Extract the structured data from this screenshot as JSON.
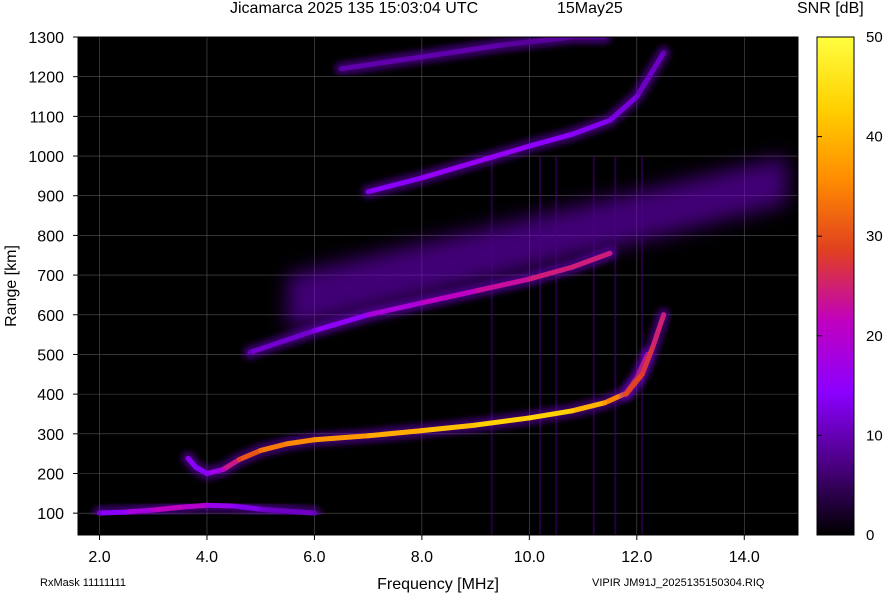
{
  "chart_data": {
    "type": "heatmap",
    "title": "Jicamarca 2025 135 15:03:04 UTC",
    "date_label": "15May25",
    "xlabel": "Frequency [MHz]",
    "ylabel": "Range [km]",
    "colorbar_label": "SNR [dB]",
    "xlim": [
      1.6,
      15.0
    ],
    "ylim": [
      45,
      1300
    ],
    "x_ticks": [
      2.0,
      4.0,
      6.0,
      8.0,
      10.0,
      12.0,
      14.0
    ],
    "x_tick_labels": [
      "2.0",
      "4.0",
      "6.0",
      "8.0",
      "10.0",
      "12.0",
      "14.0"
    ],
    "y_ticks": [
      100,
      200,
      300,
      400,
      500,
      600,
      700,
      800,
      900,
      1000,
      1100,
      1200,
      1300
    ],
    "y_tick_labels": [
      "100",
      "200",
      "300",
      "400",
      "500",
      "600",
      "700",
      "800",
      "900",
      "1000",
      "1100",
      "1200",
      "1300"
    ],
    "colorbar_ticks": [
      0,
      10,
      20,
      30,
      40,
      50
    ],
    "colorbar_tick_labels": [
      "0",
      "10",
      "20",
      "30",
      "40",
      "50"
    ],
    "colorbar_range": [
      0,
      50
    ],
    "grid": true,
    "background_color": "#000000",
    "colormap": [
      "#000000",
      "#4b0082",
      "#8b00ff",
      "#c000c0",
      "#e04020",
      "#ff8c00",
      "#ffd000",
      "#ffff40"
    ],
    "traces": [
      {
        "frequency": [
          3.65,
          3.8,
          4.0,
          4.3,
          4.6,
          5.0,
          5.5,
          6.0,
          7.0,
          8.0,
          9.0,
          10.0,
          10.8,
          11.4,
          11.8,
          12.0,
          12.2
        ],
        "range": [
          238,
          215,
          200,
          210,
          235,
          258,
          275,
          285,
          295,
          308,
          322,
          340,
          358,
          378,
          402,
          440,
          500
        ],
        "snr": [
          15,
          14,
          14,
          20,
          28,
          33,
          35,
          36,
          38,
          40,
          42,
          44,
          42,
          38,
          32,
          28,
          24
        ]
      },
      {
        "frequency": [
          11.8,
          12.1,
          12.3,
          12.5
        ],
        "range": [
          400,
          450,
          520,
          600
        ],
        "snr": [
          30,
          28,
          26,
          24
        ]
      },
      {
        "frequency": [
          4.8,
          6.0,
          7.0,
          8.0,
          9.0,
          10.0,
          10.8,
          11.5
        ],
        "range": [
          505,
          560,
          600,
          630,
          660,
          690,
          720,
          755
        ],
        "snr": [
          10,
          13,
          17,
          20,
          22,
          24,
          25,
          24
        ]
      },
      {
        "frequency": [
          7.0,
          8.0,
          9.0,
          10.0,
          10.8,
          11.5,
          12.0,
          12.5
        ],
        "range": [
          910,
          945,
          985,
          1025,
          1055,
          1090,
          1150,
          1260
        ],
        "snr": [
          13,
          15,
          16,
          15,
          14,
          13,
          12,
          10
        ]
      },
      {
        "frequency": [
          6.5,
          8.0,
          9.5,
          10.8,
          11.4
        ],
        "range": [
          1220,
          1250,
          1280,
          1300,
          1300
        ],
        "snr": [
          9,
          10,
          9,
          8,
          7
        ]
      },
      {
        "frequency": [
          2.0,
          2.5,
          3.0,
          3.5,
          4.0,
          4.5,
          5.0,
          6.0
        ],
        "range": [
          100,
          103,
          108,
          115,
          120,
          118,
          110,
          100
        ],
        "snr": [
          12,
          16,
          20,
          22,
          18,
          14,
          12,
          10
        ]
      }
    ],
    "diffuse_region": {
      "frequency": [
        5.5,
        14.8
      ],
      "range_low": [
        560,
        880
      ],
      "range_high": [
        700,
        1000
      ],
      "snr": 12
    },
    "vertical_streaks_mhz": [
      9.3,
      10.2,
      10.5,
      11.2,
      11.6,
      12.1
    ]
  },
  "footer": {
    "rxmask": "RxMask 11111111",
    "filename": "VIPIR  JM91J_2025135150304.RIQ"
  }
}
